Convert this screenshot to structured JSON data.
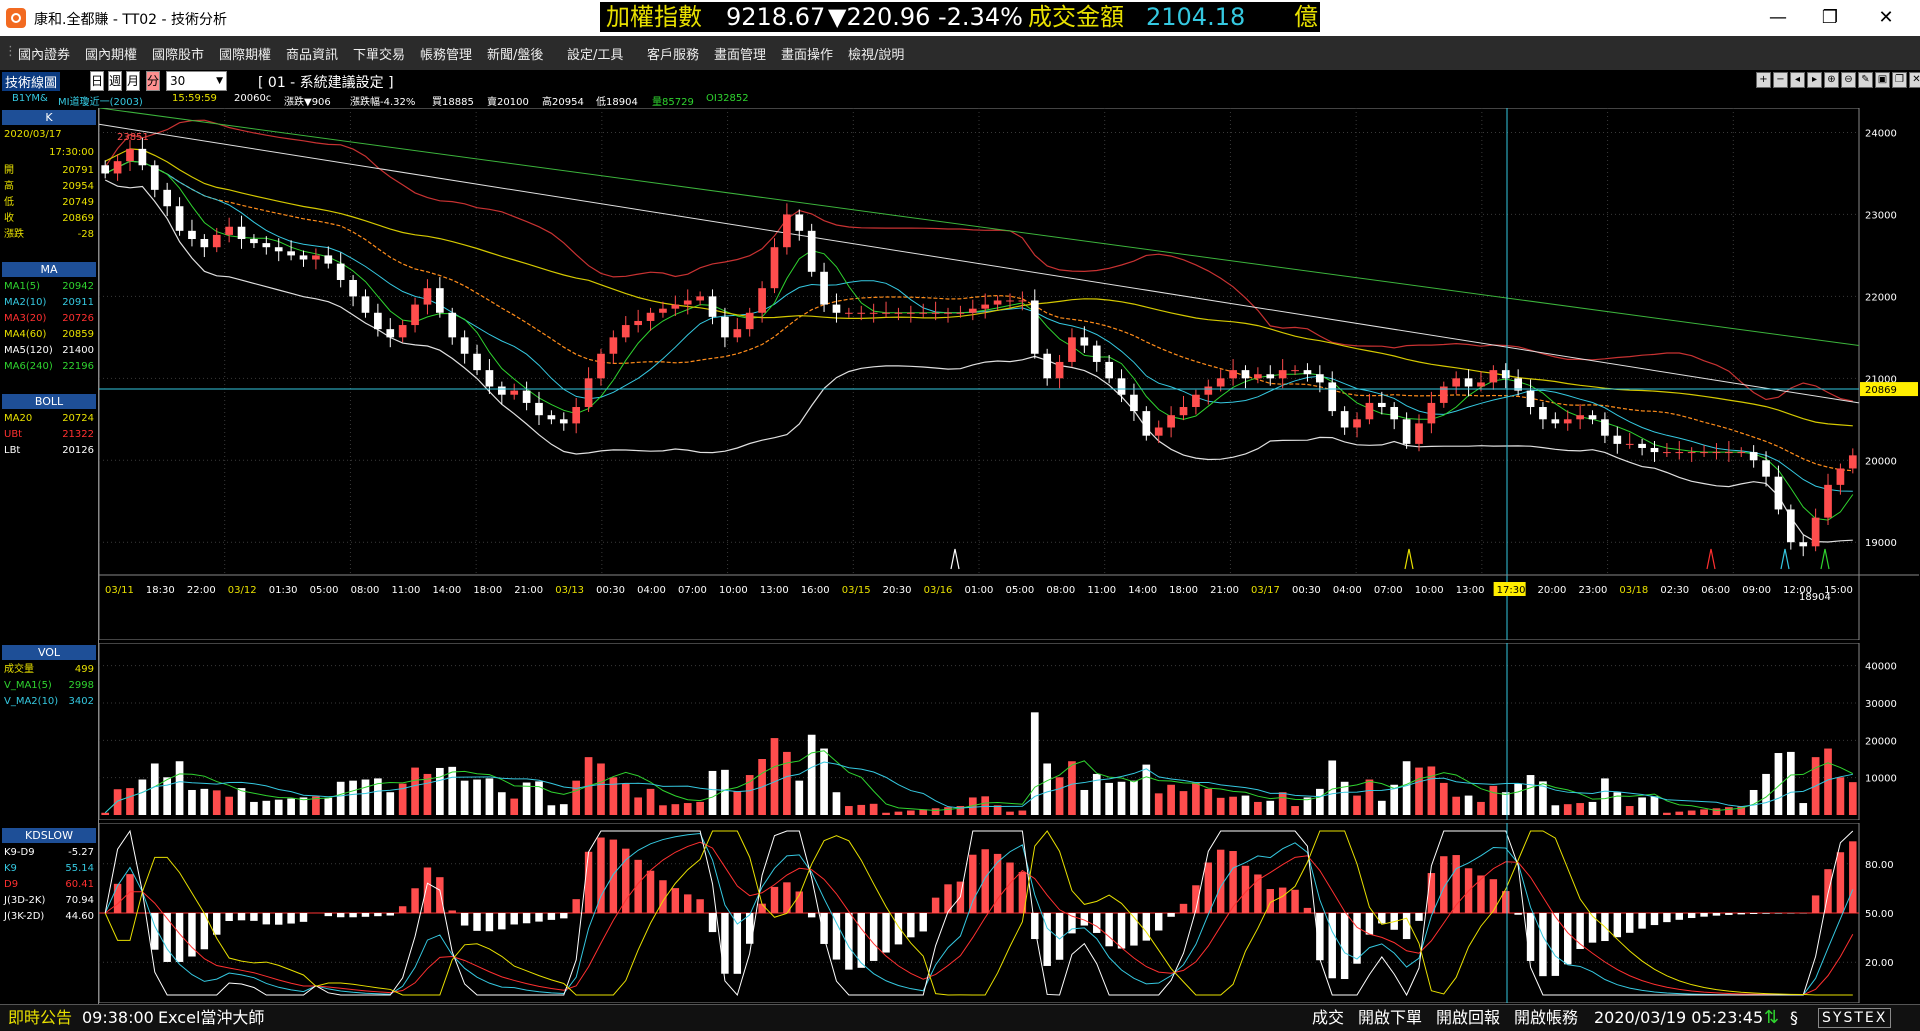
{
  "window": {
    "title": "康和.全都賺 - TT02 - 技術分析"
  },
  "ticker": {
    "name": "加權指數",
    "price": "9218.67",
    "change": "▼220.96",
    "pct": "-2.34%",
    "vol_label": "成交金額",
    "vol_value": "2104.18",
    "unit": "億"
  },
  "menu": [
    "國內證券",
    "國內期權",
    "國際股市",
    "國際期權",
    "商品資訊",
    "下單交易",
    "帳務管理",
    "新聞/盤後",
    "設定/工具",
    "客戶服務",
    "畫面管理",
    "畫面操作",
    "檢視/說明"
  ],
  "toolbar": {
    "panel_title": "技術線圖",
    "periods": [
      "日",
      "週",
      "月",
      "分"
    ],
    "interval": "30",
    "setting": "[ 01 - 系統建議設定 ]"
  },
  "infobar": {
    "symbol": "B1YM&",
    "name": "MI道瓊近一(2003)",
    "time": "15:59:59",
    "close": "20060c",
    "change_label": "漲跌▼906",
    "pct_label": "漲跌幅-4.32%",
    "bid": "買18885",
    "ask": "賣20100",
    "high": "高20954",
    "low": "低18904",
    "vol": "量85729",
    "oi": "OI32852"
  },
  "k_panel": {
    "title": "K",
    "date": "2020/03/17",
    "time": "17:30:00",
    "rows": [
      {
        "label": "開",
        "value": "20791"
      },
      {
        "label": "高",
        "value": "20954"
      },
      {
        "label": "低",
        "value": "20749"
      },
      {
        "label": "收",
        "value": "20869"
      },
      {
        "label": "漲跌",
        "value": "-28"
      }
    ]
  },
  "ma_panel": {
    "title": "MA",
    "rows": [
      {
        "label": "MA1(5)",
        "value": "20942",
        "color": "#2fd32f"
      },
      {
        "label": "MA2(10)",
        "value": "20911",
        "color": "#35c8e0"
      },
      {
        "label": "MA3(20)",
        "value": "20726",
        "color": "#ff3030"
      },
      {
        "label": "MA4(60)",
        "value": "20859",
        "color": "#e8e000"
      },
      {
        "label": "MA5(120)",
        "value": "21400",
        "color": "#ffffff"
      },
      {
        "label": "MA6(240)",
        "value": "22196",
        "color": "#2fd32f"
      }
    ]
  },
  "boll_panel": {
    "title": "BOLL",
    "rows": [
      {
        "label": "MA20",
        "value": "20724",
        "color": "#e8e000"
      },
      {
        "label": "UBt",
        "value": "21322",
        "color": "#ff3030"
      },
      {
        "label": "LBt",
        "value": "20126",
        "color": "#ffffff"
      }
    ]
  },
  "vol_panel": {
    "title": "VOL",
    "rows": [
      {
        "label": "成交量",
        "value": "499",
        "color": "#e8e000"
      },
      {
        "label": "V_MA1(5)",
        "value": "2998",
        "color": "#2fd32f"
      },
      {
        "label": "V_MA2(10)",
        "value": "3402",
        "color": "#35c8e0"
      }
    ]
  },
  "kd_panel": {
    "title": "KDSLOW",
    "rows": [
      {
        "label": "K9-D9",
        "value": "-5.27",
        "color": "#ffffff"
      },
      {
        "label": "K9",
        "value": "55.14",
        "color": "#35c8e0"
      },
      {
        "label": "D9",
        "value": "60.41",
        "color": "#ff3030"
      },
      {
        "label": "J(3D-2K)",
        "value": "70.94",
        "color": "#ffffff"
      },
      {
        "label": "J(3K-2D)",
        "value": "44.60",
        "color": "#ffffff"
      }
    ]
  },
  "price_axis": [
    "24000",
    "23000",
    "22000",
    "21000",
    "20000",
    "19000"
  ],
  "price_marker": "20869",
  "high_label": "23851",
  "low_label": "18904",
  "vol_axis": [
    "40000",
    "30000",
    "20000",
    "10000"
  ],
  "kd_axis": [
    "80.00",
    "50.00",
    "20.00"
  ],
  "time_axis": [
    {
      "t": "03/11",
      "date": true
    },
    {
      "t": "18:30"
    },
    {
      "t": "22:00"
    },
    {
      "t": "03/12",
      "date": true
    },
    {
      "t": "01:30"
    },
    {
      "t": "05:00"
    },
    {
      "t": "08:00"
    },
    {
      "t": "11:00"
    },
    {
      "t": "14:00"
    },
    {
      "t": "18:00"
    },
    {
      "t": "21:00"
    },
    {
      "t": "03/13",
      "date": true
    },
    {
      "t": "00:30"
    },
    {
      "t": "04:00"
    },
    {
      "t": "07:00"
    },
    {
      "t": "10:00"
    },
    {
      "t": "13:00"
    },
    {
      "t": "16:00"
    },
    {
      "t": "03/15",
      "date": true
    },
    {
      "t": "20:30"
    },
    {
      "t": "03/16",
      "date": true
    },
    {
      "t": "01:00"
    },
    {
      "t": "05:00"
    },
    {
      "t": "08:00"
    },
    {
      "t": "11:00"
    },
    {
      "t": "14:00"
    },
    {
      "t": "18:00"
    },
    {
      "t": "21:00"
    },
    {
      "t": "03/17",
      "date": true
    },
    {
      "t": "00:30"
    },
    {
      "t": "04:00"
    },
    {
      "t": "07:00"
    },
    {
      "t": "10:00"
    },
    {
      "t": "13:00"
    },
    {
      "t": "17:30",
      "cursor": true
    },
    {
      "t": "20:00"
    },
    {
      "t": "23:00"
    },
    {
      "t": "03/18",
      "date": true
    },
    {
      "t": "02:30"
    },
    {
      "t": "06:00"
    },
    {
      "t": "09:00"
    },
    {
      "t": "12:00"
    },
    {
      "t": "15:00"
    }
  ],
  "status": {
    "announce": "即時公告",
    "time": "09:38:00",
    "msg": "Excel當沖大師",
    "b1": "成交",
    "b2": "開啟下單",
    "b3": "開啟回報",
    "b4": "開啟帳務",
    "datetime": "2020/03/19 05:23:45",
    "brand": "SYSTEX"
  },
  "colors": {
    "up": "#ff4d4d",
    "down": "#ffffff",
    "ma5": "#2fd32f",
    "ma10": "#35c8e0",
    "ma20": "#ff8c1a",
    "panel": "#1e4f97",
    "ticker": "#e8e000"
  },
  "chart_data": {
    "type": "candlestick",
    "closes": [
      23500,
      23650,
      23800,
      23600,
      23300,
      23100,
      22800,
      22700,
      22600,
      22750,
      22850,
      22700,
      22650,
      22600,
      22550,
      22500,
      22450,
      22500,
      22400,
      22200,
      22000,
      21800,
      21600,
      21500,
      21650,
      21900,
      22100,
      21800,
      21500,
      21300,
      21100,
      20900,
      20800,
      20850,
      20700,
      20550,
      20500,
      20450,
      20650,
      21000,
      21300,
      21500,
      21650,
      21700,
      21800,
      21850,
      21900,
      21950,
      22000,
      21750,
      21500,
      21600,
      21800,
      22100,
      22600,
      23000,
      22800,
      22300,
      21900,
      21800,
      21800,
      21800,
      21800,
      21800,
      21800,
      21800,
      21800,
      21800,
      21800,
      21800,
      21850,
      21900,
      21950,
      21950,
      21950,
      21300,
      21000,
      21200,
      21500,
      21400,
      21200,
      21000,
      20800,
      20600,
      20300,
      20400,
      20550,
      20650,
      20800,
      20900,
      21000,
      21100,
      21000,
      21050,
      21000,
      21100,
      21100,
      21050,
      20950,
      20600,
      20400,
      20500,
      20700,
      20650,
      20500,
      20200,
      20450,
      20700,
      20900,
      21000,
      20900,
      20950,
      21100,
      21000,
      20850,
      20650,
      20500,
      20450,
      20500,
      20550,
      20500,
      20300,
      20200,
      20200,
      20150,
      20100,
      20100,
      20100,
      20100,
      20100,
      20100,
      20100,
      20100,
      20000,
      19800,
      19400,
      19000,
      18950,
      19300,
      19700,
      19900,
      20060
    ],
    "price_range": [
      18600,
      24250
    ],
    "volume_range": [
      0,
      45000
    ],
    "kd_range": [
      0,
      100
    ]
  }
}
